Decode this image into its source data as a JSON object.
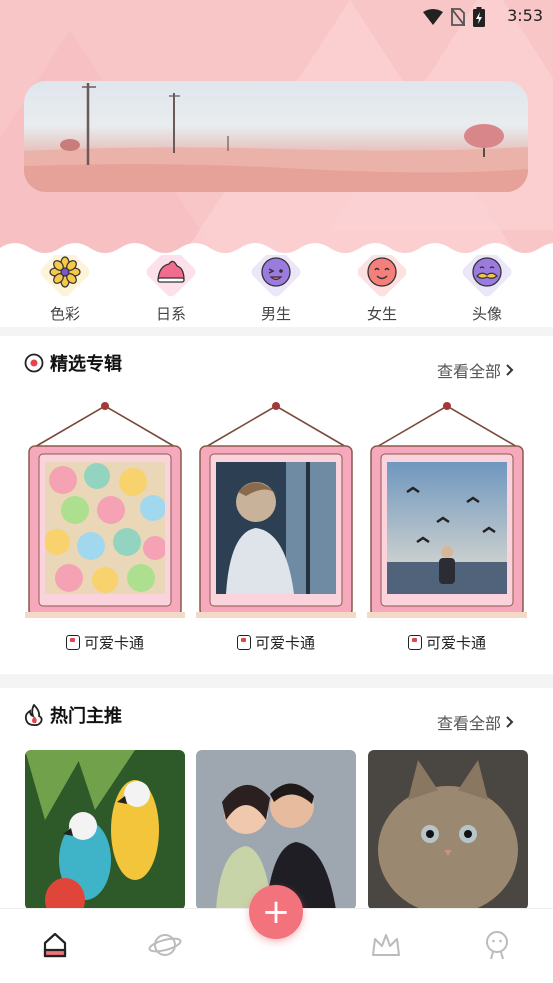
{
  "status_bar": {
    "time": "3:53"
  },
  "categories": [
    {
      "label": "色彩",
      "icon": "flower-icon"
    },
    {
      "label": "日系",
      "icon": "sushi-icon"
    },
    {
      "label": "男生",
      "icon": "boy-face-icon"
    },
    {
      "label": "女生",
      "icon": "girl-face-icon"
    },
    {
      "label": "头像",
      "icon": "mustache-face-icon"
    }
  ],
  "featured": {
    "title": "精选专辑",
    "see_all": "查看全部",
    "albums": [
      {
        "caption": "可爱卡通"
      },
      {
        "caption": "可爱卡通"
      },
      {
        "caption": "可爱卡通"
      }
    ]
  },
  "hot": {
    "title": "热门主推",
    "see_all": "查看全部"
  },
  "nav": {
    "items": [
      "home-icon",
      "planet-icon",
      "add-icon",
      "crown-icon",
      "profile-icon"
    ],
    "fab_label": "+"
  },
  "colors": {
    "header_pink": "#f9c6c8",
    "accent_red": "#f2737b",
    "frame_pink": "#f6a9bd"
  }
}
